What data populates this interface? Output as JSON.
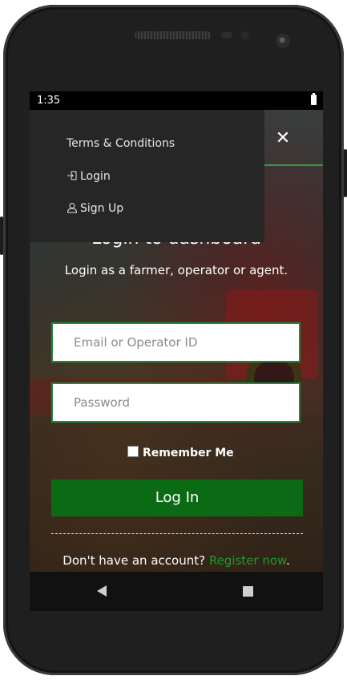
{
  "status_bar": {
    "time": "1:35"
  },
  "menu": {
    "items": [
      {
        "label": "Terms & Conditions",
        "icon": ""
      },
      {
        "label": "Login",
        "icon": "login-icon"
      },
      {
        "label": "Sign Up",
        "icon": "user-icon"
      }
    ]
  },
  "header": {
    "close_label": "✕"
  },
  "main": {
    "title": "Login to dashboard",
    "subtitle": "Login as a farmer, operator or agent.",
    "email_placeholder": "Email or Operator ID",
    "password_placeholder": "Password",
    "remember_label": "Remember Me",
    "login_button": "Log In",
    "signup_prompt": "Don't have an account? ",
    "signup_link": "Register now",
    "signup_suffix": "."
  },
  "colors": {
    "accent": "#0b6b14",
    "link": "#1e9a2a",
    "input_border": "#1e8a3c",
    "menu_bg": "#262626"
  },
  "navigation": {
    "back_icon": "back-icon",
    "home_icon": "home-icon"
  }
}
